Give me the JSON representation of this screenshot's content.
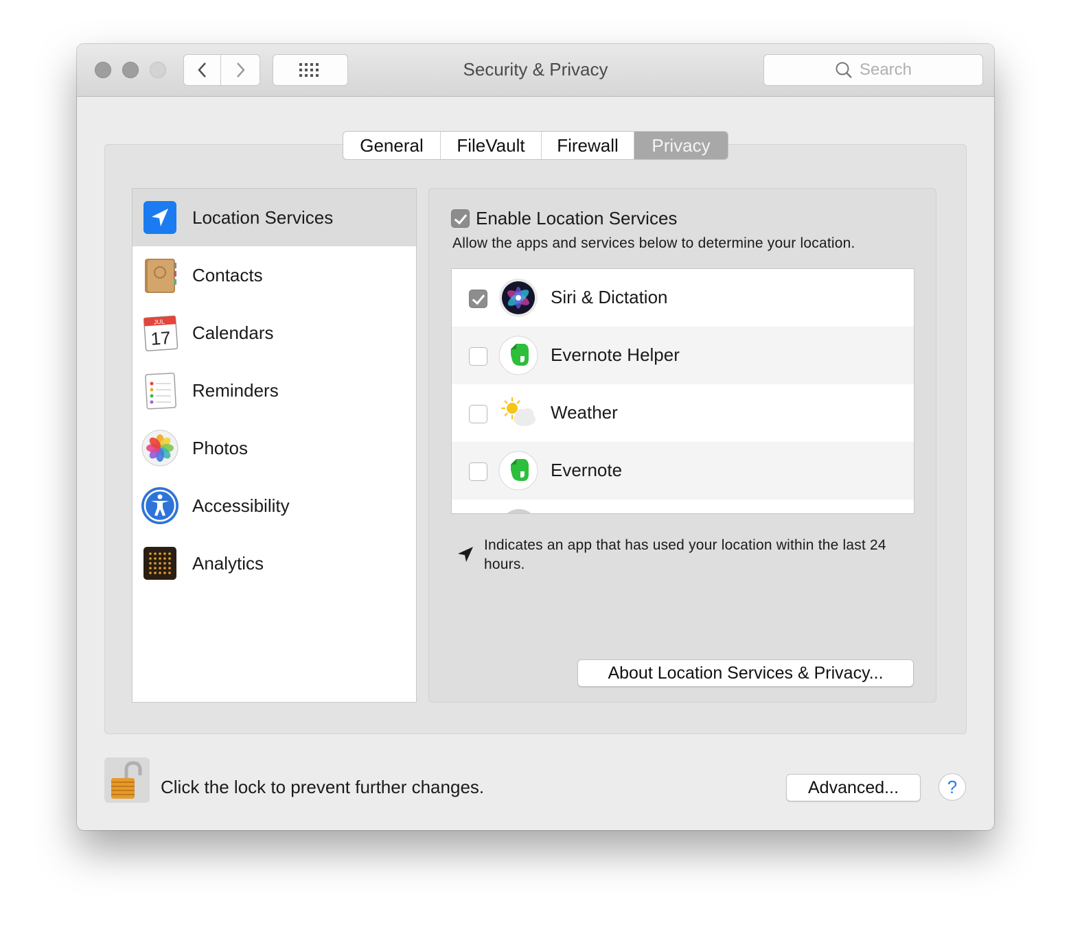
{
  "window": {
    "title": "Security & Privacy"
  },
  "toolbar": {
    "search_placeholder": "Search"
  },
  "tabs": [
    {
      "label": "General",
      "selected": false
    },
    {
      "label": "FileVault",
      "selected": false
    },
    {
      "label": "Firewall",
      "selected": false
    },
    {
      "label": "Privacy",
      "selected": true
    }
  ],
  "sidebar": {
    "items": [
      {
        "label": "Location Services",
        "icon": "location-arrow-icon",
        "selected": true
      },
      {
        "label": "Contacts",
        "icon": "contacts-book-icon",
        "selected": false
      },
      {
        "label": "Calendars",
        "icon": "calendar-icon",
        "selected": false,
        "calendar_month": "JUL",
        "calendar_day": "17"
      },
      {
        "label": "Reminders",
        "icon": "reminders-list-icon",
        "selected": false
      },
      {
        "label": "Photos",
        "icon": "photos-flower-icon",
        "selected": false
      },
      {
        "label": "Accessibility",
        "icon": "accessibility-person-icon",
        "selected": false
      },
      {
        "label": "Analytics",
        "icon": "analytics-dots-icon",
        "selected": false
      }
    ]
  },
  "location": {
    "enable_label": "Enable Location Services",
    "enabled": true,
    "description": "Allow the apps and services below to determine your location.",
    "apps": [
      {
        "label": "Siri & Dictation",
        "checked": true,
        "icon": "siri-icon"
      },
      {
        "label": "Evernote Helper",
        "checked": false,
        "icon": "evernote-elephant-icon"
      },
      {
        "label": "Weather",
        "checked": false,
        "icon": "weather-sun-cloud-icon"
      },
      {
        "label": "Evernote",
        "checked": false,
        "icon": "evernote-elephant-icon"
      }
    ],
    "note": "Indicates an app that has used your location within the last 24 hours.",
    "about_button": "About Location Services & Privacy..."
  },
  "footer": {
    "lock_text": "Click the lock to prevent further changes.",
    "advanced_button": "Advanced...",
    "help_label": "?"
  },
  "colors": {
    "location_blue": "#1a7cf0",
    "evernote_green": "#2dbe3c",
    "help_blue": "#2b7ce9"
  }
}
